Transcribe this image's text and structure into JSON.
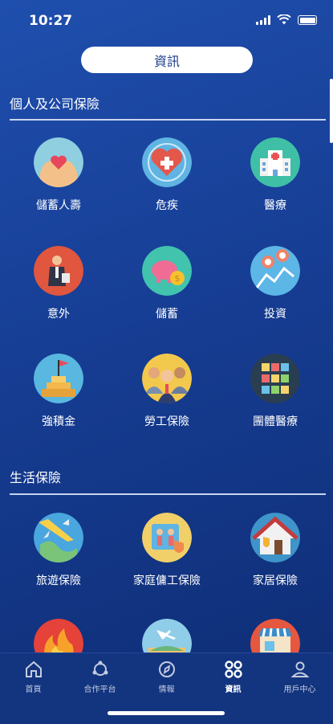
{
  "status": {
    "time": "10:27"
  },
  "header": {
    "title": "資訊"
  },
  "sections": [
    {
      "title": "個人及公司保險",
      "items": [
        {
          "label": "儲蓄人壽",
          "icon": "hands-heart-icon"
        },
        {
          "label": "危疾",
          "icon": "heart-cross-icon"
        },
        {
          "label": "醫療",
          "icon": "hospital-icon"
        },
        {
          "label": "意外",
          "icon": "injured-person-icon"
        },
        {
          "label": "儲蓄",
          "icon": "piggy-bank-icon"
        },
        {
          "label": "投資",
          "icon": "investment-pins-icon"
        },
        {
          "label": "強積金",
          "icon": "flag-steps-icon"
        },
        {
          "label": "勞工保險",
          "icon": "workers-icon"
        },
        {
          "label": "團體醫療",
          "icon": "group-medical-icon"
        }
      ]
    },
    {
      "title": "生活保險",
      "items": [
        {
          "label": "旅遊保險",
          "icon": "plane-globe-icon"
        },
        {
          "label": "家庭傭工保險",
          "icon": "helper-icon"
        },
        {
          "label": "家居保險",
          "icon": "house-shield-icon"
        },
        {
          "label": "",
          "icon": "fire-icon"
        },
        {
          "label": "",
          "icon": "travel-scene-icon"
        },
        {
          "label": "",
          "icon": "shop-icon"
        }
      ]
    }
  ],
  "tabs": [
    {
      "label": "首頁",
      "icon": "home-icon"
    },
    {
      "label": "合作平台",
      "icon": "partner-icon"
    },
    {
      "label": "情報",
      "icon": "compass-icon"
    },
    {
      "label": "資訊",
      "icon": "info-grid-icon",
      "active": true
    },
    {
      "label": "用戶中心",
      "icon": "user-icon"
    }
  ]
}
